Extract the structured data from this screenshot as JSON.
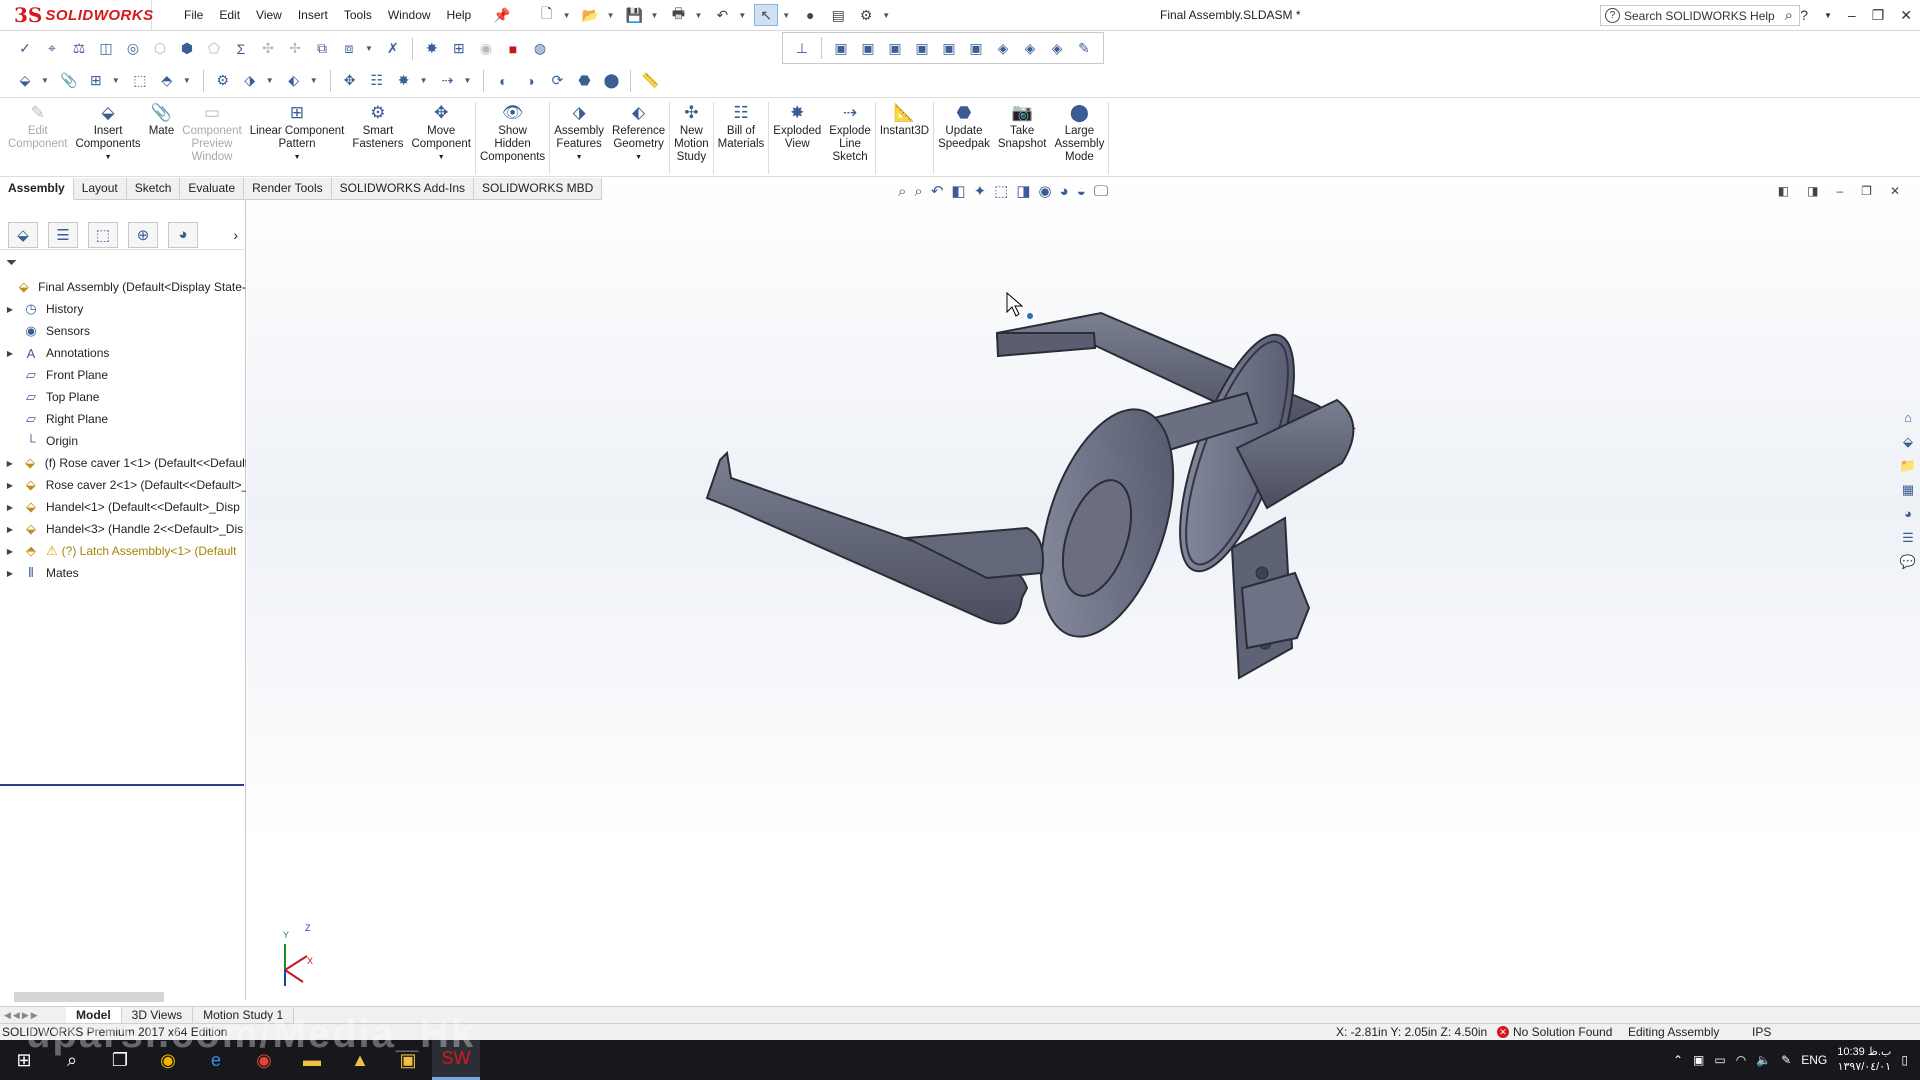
{
  "app": {
    "logo_ds": "3S",
    "logo_text": "SOLIDWORKS",
    "document_title": "Final Assembly.SLDASM *"
  },
  "menu": [
    "File",
    "Edit",
    "View",
    "Insert",
    "Tools",
    "Window",
    "Help"
  ],
  "help_search": {
    "placeholder": "Search SOLIDWORKS Help"
  },
  "command_manager": [
    {
      "label": "Edit\nComponent",
      "disabled": true
    },
    {
      "label": "Insert\nComponents",
      "disabled": false
    },
    {
      "label": "Mate",
      "disabled": false
    },
    {
      "label": "Component\nPreview\nWindow",
      "disabled": true
    },
    {
      "label": "Linear Component\nPattern",
      "disabled": false
    },
    {
      "label": "Smart\nFasteners",
      "disabled": false
    },
    {
      "label": "Move\nComponent",
      "disabled": false
    },
    {
      "label": "Show\nHidden\nComponents",
      "disabled": false
    },
    {
      "label": "Assembly\nFeatures",
      "disabled": false
    },
    {
      "label": "Reference\nGeometry",
      "disabled": false
    },
    {
      "label": "New\nMotion\nStudy",
      "disabled": false
    },
    {
      "label": "Bill of\nMaterials",
      "disabled": false
    },
    {
      "label": "Exploded\nView",
      "disabled": false
    },
    {
      "label": "Explode\nLine\nSketch",
      "disabled": false
    },
    {
      "label": "Instant3D",
      "disabled": false
    },
    {
      "label": "Update\nSpeedpak",
      "disabled": false
    },
    {
      "label": "Take\nSnapshot",
      "disabled": false
    },
    {
      "label": "Large\nAssembly\nMode",
      "disabled": false
    }
  ],
  "tabs": [
    "Assembly",
    "Layout",
    "Sketch",
    "Evaluate",
    "Render Tools",
    "SOLIDWORKS Add-Ins",
    "SOLIDWORKS MBD"
  ],
  "active_tab": "Assembly",
  "tree": [
    {
      "label": "Final Assembly  (Default<Display State-1>",
      "expand": "",
      "icon": "assembly-icon",
      "root": true
    },
    {
      "label": "History",
      "expand": "▶",
      "icon": "history-icon"
    },
    {
      "label": "Sensors",
      "expand": "",
      "icon": "sensor-icon"
    },
    {
      "label": "Annotations",
      "expand": "▶",
      "icon": "annotation-icon"
    },
    {
      "label": "Front Plane",
      "expand": "",
      "icon": "plane-icon"
    },
    {
      "label": "Top Plane",
      "expand": "",
      "icon": "plane-icon"
    },
    {
      "label": "Right Plane",
      "expand": "",
      "icon": "plane-icon"
    },
    {
      "label": "Origin",
      "expand": "",
      "icon": "origin-icon"
    },
    {
      "label": "(f) Rose caver 1<1> (Default<<Default>",
      "expand": "▶",
      "icon": "part-icon"
    },
    {
      "label": "Rose caver 2<1> (Default<<Default>_",
      "expand": "▶",
      "icon": "part-icon"
    },
    {
      "label": "Handel<1> (Default<<Default>_Disp",
      "expand": "▶",
      "icon": "part-icon"
    },
    {
      "label": "Handel<3> (Handle 2<<Default>_Dis",
      "expand": "▶",
      "icon": "part-icon"
    },
    {
      "label": "(?) Latch Assembbly<1> (Default",
      "expand": "▶",
      "icon": "subassembly-icon",
      "warning": true
    },
    {
      "label": "Mates",
      "expand": "▶",
      "icon": "mates-icon"
    }
  ],
  "bottom_tabs": [
    "Model",
    "3D Views",
    "Motion Study 1"
  ],
  "active_bottom_tab": "Model",
  "status": {
    "edition": "SOLIDWORKS Premium 2017 x64 Edition",
    "coords": "X: -2.81in Y: 2.05in Z: 4.50in",
    "solution": "No Solution Found",
    "mode": "Editing Assembly",
    "units": "IPS"
  },
  "taskbar": {
    "lang": "ENG",
    "time": "10:39 ب.ظ",
    "date": "١٣٩٧/٠٤/٠١"
  },
  "triad": {
    "z": "Z",
    "x": "X",
    "y": "Y"
  },
  "watermark": "uparsi.com/Media_Hk"
}
